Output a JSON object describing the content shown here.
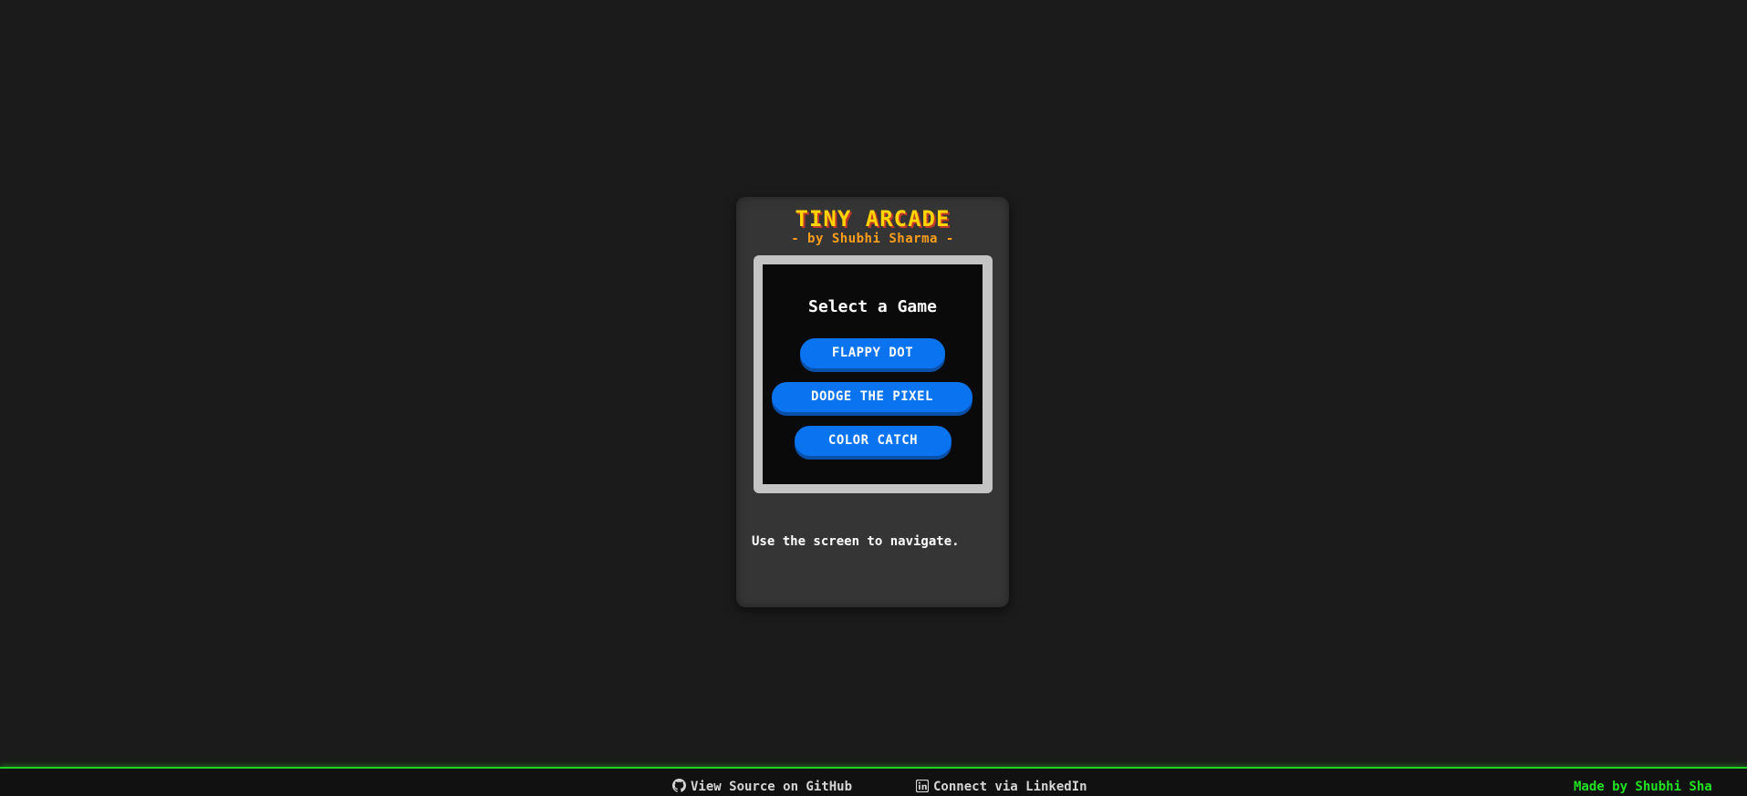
{
  "header": {
    "title": "TINY ARCADE",
    "subtitle": "- by Shubhi Sharma -"
  },
  "screen": {
    "heading": "Select a Game",
    "games": [
      {
        "label": "FLAPPY DOT"
      },
      {
        "label": "DODGE THE PIXEL"
      },
      {
        "label": "COLOR CATCH"
      }
    ]
  },
  "hint": "Use the screen to navigate.",
  "footer": {
    "github_label": "View Source on GitHub",
    "github_icon": "github-icon",
    "linkedin_label": "Connect via LinkedIn",
    "linkedin_icon": "linkedin-icon",
    "made_by": "Made by Shubhi Sha"
  },
  "colors": {
    "background": "#1b1b1b",
    "console": "#353535",
    "title": "#ffd400",
    "subtitle": "#ff9e1b",
    "button": "#0a74f0",
    "footer_accent": "#22d322"
  }
}
